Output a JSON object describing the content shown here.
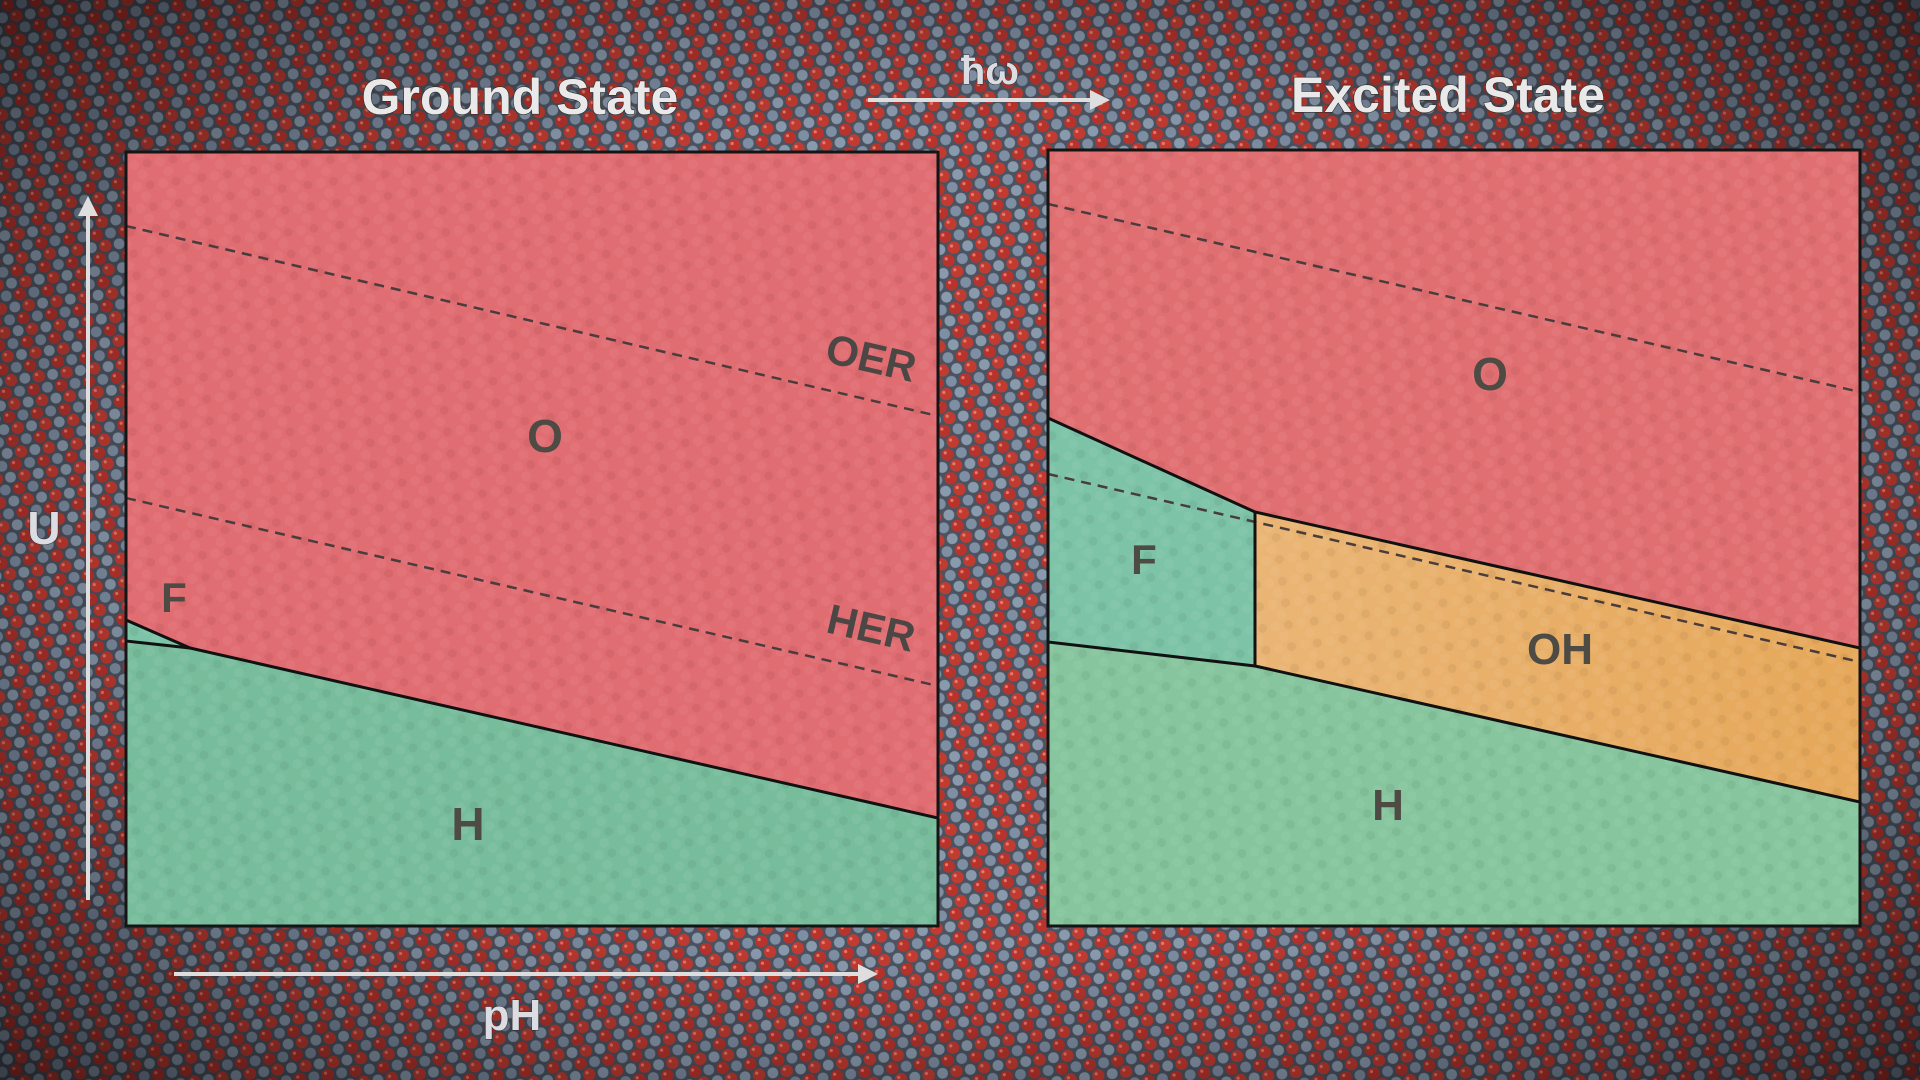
{
  "transition_symbol": "ħω",
  "colors": {
    "O_region": "#e06d72",
    "F_region": "#7cc3a8",
    "H_region": "#77bd9c",
    "OH_region": "#e9b16b",
    "boundary": "#111111",
    "dashed": "#4a3c3c",
    "axis_arrow": "#dedede"
  },
  "axes": {
    "y_label": "U",
    "x_label": "pH"
  },
  "panels": {
    "ground": {
      "title": "Ground State",
      "regions": {
        "O": "O",
        "F": "F",
        "H": "H"
      },
      "lines": {
        "oer": "OER",
        "her": "HER"
      }
    },
    "excited": {
      "title": "Excited State",
      "regions": {
        "O": "O",
        "F": "F",
        "OH": "OH",
        "H": "H"
      }
    }
  }
}
